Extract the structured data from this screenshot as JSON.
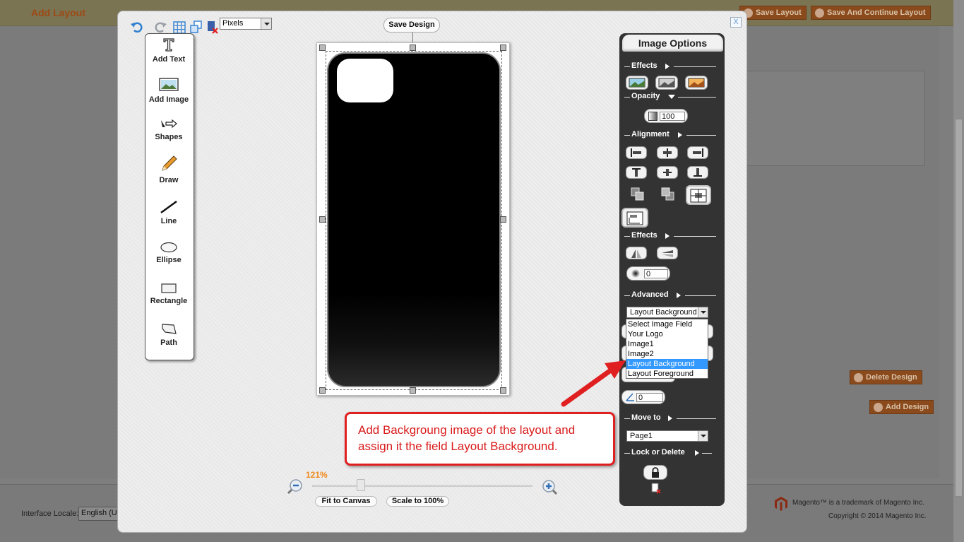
{
  "header": {
    "page_title": "Add Layout",
    "buttons": [
      "Save Layout",
      "Save And Continue Layout"
    ]
  },
  "toolbar": {
    "units": "Pixels",
    "save_design": "Save Design",
    "close": "X"
  },
  "tools": [
    {
      "label": "Add Text",
      "icon": "text-icon"
    },
    {
      "label": "Add Image",
      "icon": "image-icon"
    },
    {
      "label": "Shapes",
      "icon": "shapes-icon"
    },
    {
      "label": "Draw",
      "icon": "pencil-icon"
    },
    {
      "label": "Line",
      "icon": "line-icon"
    },
    {
      "label": "Ellipse",
      "icon": "ellipse-icon"
    },
    {
      "label": "Rectangle",
      "icon": "rectangle-icon"
    },
    {
      "label": "Path",
      "icon": "path-icon"
    }
  ],
  "zoom": {
    "percent": "121%",
    "level": 0.22,
    "fit_to_canvas": "Fit to Canvas",
    "scale_to_100": "Scale to 100%"
  },
  "options": {
    "title": "Image Options",
    "effects_label": "Effects",
    "opacity_label": "Opacity",
    "opacity_value": "100",
    "alignment_label": "Alignment",
    "effects2_label": "Effects",
    "blur_value": "0",
    "advanced_label": "Advanced",
    "advanced_selected": "Layout Background",
    "advanced_options": [
      "Select Image Field",
      "Your Logo",
      "Image1",
      "Image2",
      "Layout Background",
      "Layout Foreground"
    ],
    "angle_value": "0",
    "move_to_label": "Move to",
    "move_to_value": "Page1",
    "lock_delete_label": "Lock or Delete"
  },
  "callout": {
    "text": "Add Backgroung image of the layout and assign it the field Layout Background."
  },
  "side_buttons": {
    "delete_design": "Delete Design",
    "add_design": "Add Design"
  },
  "footer": {
    "locale_label": "Interface Locale:",
    "locale_value": "English (U",
    "trademark": "Magento™ is a trademark of Magento Inc.",
    "copyright": "Copyright © 2014 Magento Inc."
  },
  "colors": {
    "accent_orange": "#f08a1c",
    "callout_red": "#e02020",
    "panel_dark": "#333333",
    "selection_blue": "#3399ff"
  }
}
